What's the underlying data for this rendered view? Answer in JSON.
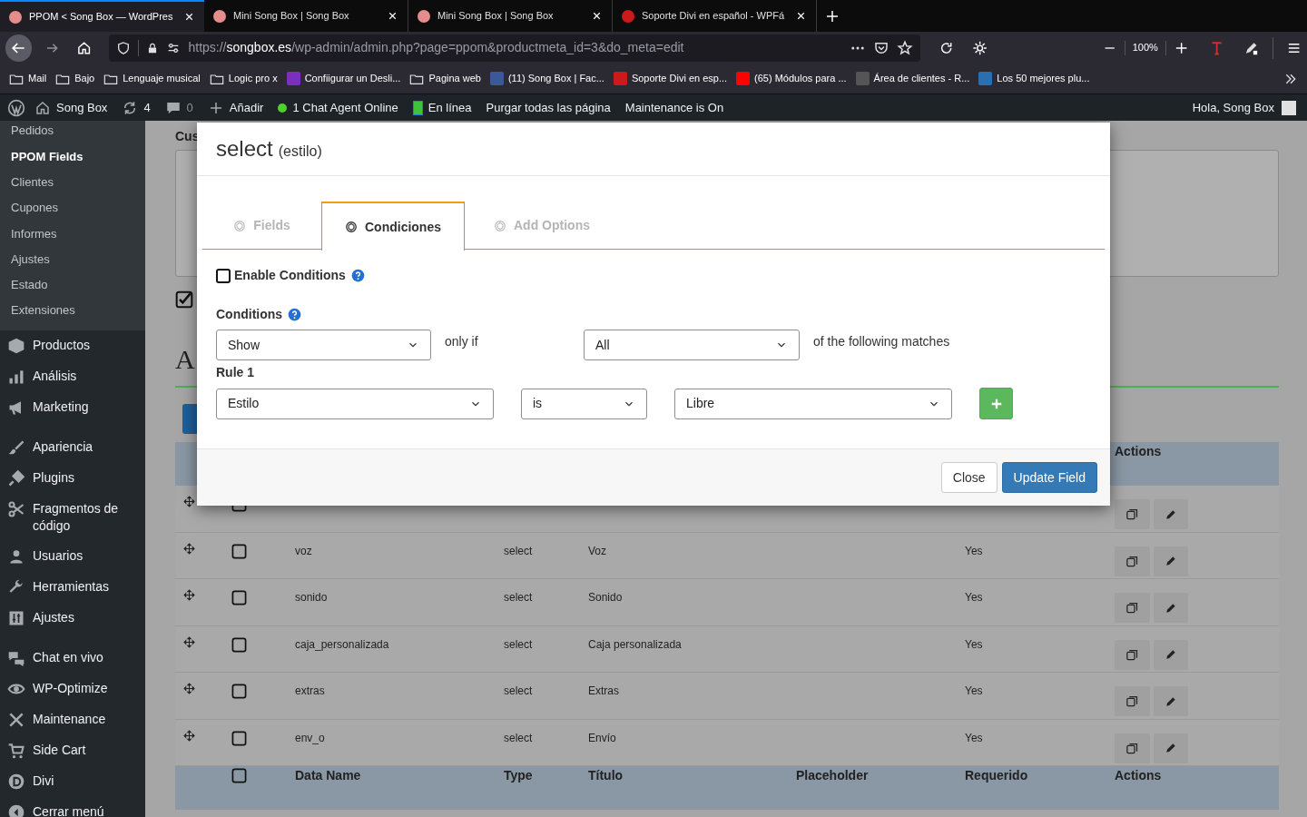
{
  "browser": {
    "tabs": [
      {
        "title": "PPOM < Song Box — WordPres",
        "selected": true,
        "color": "#e58c8c"
      },
      {
        "title": "Mini Song Box | Song Box",
        "selected": false,
        "color": "#e58c8c"
      },
      {
        "title": "Mini Song Box | Song Box",
        "selected": false,
        "color": "#e58c8c"
      },
      {
        "title": "Soporte Divi en español - WPFá",
        "selected": false,
        "color": "#cc1a1a"
      }
    ],
    "url": {
      "scheme": "https://",
      "host": "songbox.es",
      "path": "/wp-admin/admin.php?page=ppom&productmeta_id=3&do_meta=edit"
    },
    "zoom": "100%",
    "bookmarks": [
      {
        "label": "Mail",
        "kind": "folder"
      },
      {
        "label": "Bajo",
        "kind": "folder"
      },
      {
        "label": "Lenguaje musical",
        "kind": "folder"
      },
      {
        "label": "Logic pro x",
        "kind": "folder"
      },
      {
        "label": "Confiigurar un Desli...",
        "kind": "site",
        "color": "#7b2fbf"
      },
      {
        "label": "Pagina web",
        "kind": "folder"
      },
      {
        "label": "(11) Song Box | Fac...",
        "kind": "site",
        "color": "#3b5998"
      },
      {
        "label": "Soporte Divi en esp...",
        "kind": "site",
        "color": "#cc1a1a"
      },
      {
        "label": "(65) Módulos para ...",
        "kind": "site",
        "color": "#ff0000"
      },
      {
        "label": "Área de clientes - R...",
        "kind": "site",
        "color": "#555555"
      },
      {
        "label": "Los 50 mejores plu...",
        "kind": "site",
        "color": "#2a6fb0"
      }
    ]
  },
  "admin_bar": {
    "site": "Song Box",
    "updates": "4",
    "comments": "0",
    "new": "Añadir",
    "chat": "1 Chat Agent Online",
    "status": "En línea",
    "purge": "Purgar todas las página",
    "maintenance": "Maintenance is On",
    "greeting": "Hola, Song Box"
  },
  "sidebar": {
    "submenu": [
      {
        "label": "Pedidos",
        "selected": false
      },
      {
        "label": "PPOM Fields",
        "selected": true
      },
      {
        "label": "Clientes",
        "selected": false
      },
      {
        "label": "Cupones",
        "selected": false
      },
      {
        "label": "Informes",
        "selected": false
      },
      {
        "label": "Ajustes",
        "selected": false
      },
      {
        "label": "Estado",
        "selected": false
      },
      {
        "label": "Extensiones",
        "selected": false
      }
    ],
    "menu": [
      {
        "label": "Productos"
      },
      {
        "label": "Análisis"
      },
      {
        "label": "Marketing"
      },
      {
        "label": "Apariencia"
      },
      {
        "label": "Plugins"
      },
      {
        "label": "Fragmentos de código"
      },
      {
        "label": "Usuarios"
      },
      {
        "label": "Herramientas"
      },
      {
        "label": "Ajustes"
      },
      {
        "label": "Chat en vivo"
      },
      {
        "label": "WP-Optimize"
      },
      {
        "label": "Maintenance"
      },
      {
        "label": "Side Cart"
      },
      {
        "label": "Divi"
      },
      {
        "label": "Cerrar menú"
      }
    ]
  },
  "page": {
    "section_label": "Cus",
    "option_checked": true,
    "heading": "A",
    "table": {
      "header_actions": "Actions",
      "rows": [
        {
          "checked": false
        },
        {
          "checked": false,
          "data_name": "voz",
          "type": "select",
          "title": "Voz",
          "required": "Yes"
        },
        {
          "checked": false,
          "data_name": "sonido",
          "type": "select",
          "title": "Sonido",
          "required": "Yes"
        },
        {
          "checked": false,
          "data_name": "caja_personalizada",
          "type": "select",
          "title": "Caja personalizada",
          "required": "Yes"
        },
        {
          "checked": false,
          "data_name": "extras",
          "type": "select",
          "title": "Extras",
          "required": "Yes"
        },
        {
          "checked": false,
          "data_name": "env_o",
          "type": "select",
          "title": "Envío",
          "required": "Yes"
        }
      ],
      "select_all_checked": false,
      "footer_columns": [
        "Data Name",
        "Type",
        "Título",
        "Placeholder",
        "Requerido",
        "Actions"
      ]
    }
  },
  "modal": {
    "title": "select",
    "subtitle": "(estilo)",
    "tabs": [
      {
        "label": "Fields",
        "selected": false
      },
      {
        "label": "Condiciones",
        "selected": true
      },
      {
        "label": "Add Options",
        "selected": false
      }
    ],
    "enable_conditions": {
      "label": "Enable Conditions",
      "checked": false
    },
    "conditions_label": "Conditions",
    "action": "Show",
    "only_if": "only if",
    "match": "All",
    "matches_text": "of the following matches",
    "rule_label": "Rule 1",
    "rule": {
      "field": "Estilo",
      "operator": "is",
      "value": "Libre"
    },
    "buttons": {
      "close": "Close",
      "update": "Update Field"
    }
  }
}
